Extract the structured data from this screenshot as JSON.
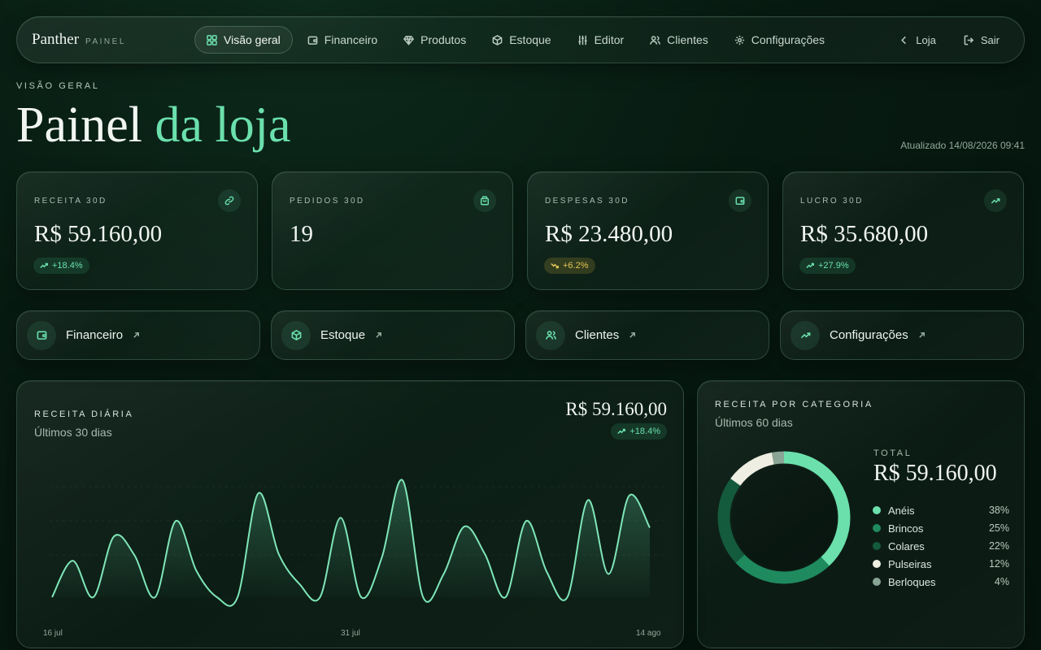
{
  "brand": {
    "name": "Panther",
    "sub": "PAINEL"
  },
  "nav": {
    "items": [
      {
        "label": "Visão geral",
        "icon": "grid-icon",
        "active": true
      },
      {
        "label": "Financeiro",
        "icon": "wallet-icon",
        "active": false
      },
      {
        "label": "Produtos",
        "icon": "diamond-icon",
        "active": false
      },
      {
        "label": "Estoque",
        "icon": "box-icon",
        "active": false
      },
      {
        "label": "Editor",
        "icon": "sliders-icon",
        "active": false
      },
      {
        "label": "Clientes",
        "icon": "users-icon",
        "active": false
      },
      {
        "label": "Configurações",
        "icon": "gear-icon",
        "active": false
      }
    ],
    "loja": "Loja",
    "sair": "Sair"
  },
  "header": {
    "eyebrow": "VISÃO GERAL",
    "title_main": "Painel",
    "title_accent": "da loja",
    "updated": "Atualizado 14/08/2026 09:41"
  },
  "kpis": [
    {
      "label": "RECEITA 30D",
      "value": "R$ 59.160,00",
      "badge": "+18.4%",
      "icon": "link-icon"
    },
    {
      "label": "PEDIDOS 30D",
      "value": "19",
      "badge": "",
      "icon": "bag-icon"
    },
    {
      "label": "DESPESAS 30D",
      "value": "R$ 23.480,00",
      "badge": "+6.2%",
      "icon": "wallet-icon"
    },
    {
      "label": "LUCRO 30D",
      "value": "R$ 35.680,00",
      "badge": "+27.9%",
      "icon": "trend-up-icon"
    }
  ],
  "quick_links": [
    {
      "label": "Financeiro",
      "icon": "wallet-icon"
    },
    {
      "label": "Estoque",
      "icon": "box-icon"
    },
    {
      "label": "Clientes",
      "icon": "users-icon"
    },
    {
      "label": "Configurações",
      "icon": "trend-up-icon"
    }
  ],
  "revenue": {
    "title": "RECEITA DIÁRIA",
    "subtitle": "Últimos 30 dias",
    "total": "R$ 59.160,00",
    "badge": "+18.4%",
    "xticks": [
      "16 jul",
      "31 jul",
      "14 ago"
    ]
  },
  "category": {
    "title": "RECEITA POR CATEGORIA",
    "subtitle": "Últimos 60 dias",
    "total_label": "TOTAL",
    "total_value": "R$ 59.160,00",
    "items": [
      {
        "name": "Anéis",
        "pct": "38%",
        "color": "#6be0ad"
      },
      {
        "name": "Brincos",
        "pct": "25%",
        "color": "#1f8a5e"
      },
      {
        "name": "Colares",
        "pct": "22%",
        "color": "#145a3c"
      },
      {
        "name": "Pulseiras",
        "pct": "12%",
        "color": "#eeeee2"
      },
      {
        "name": "Berloques",
        "pct": "4%",
        "color": "#8aa596"
      }
    ]
  },
  "chart_data": {
    "type": "area",
    "title": "RECEITA DIÁRIA",
    "x": [
      "16 jul",
      "17 jul",
      "18 jul",
      "19 jul",
      "20 jul",
      "21 jul",
      "22 jul",
      "23 jul",
      "24 jul",
      "25 jul",
      "26 jul",
      "27 jul",
      "28 jul",
      "29 jul",
      "30 jul",
      "31 jul",
      "01 ago",
      "02 ago",
      "03 ago",
      "04 ago",
      "05 ago",
      "06 ago",
      "07 ago",
      "08 ago",
      "09 ago",
      "10 ago",
      "11 ago",
      "12 ago",
      "13 ago",
      "14 ago"
    ],
    "values": [
      0,
      1650,
      0,
      2750,
      1900,
      0,
      3450,
      1200,
      0,
      0,
      4700,
      1950,
      600,
      0,
      3600,
      0,
      1800,
      5300,
      0,
      1050,
      3200,
      1950,
      0,
      3450,
      1150,
      0,
      4400,
      1050,
      4600,
      3150
    ],
    "xticks": [
      "16 jul",
      "31 jul",
      "14 ago"
    ],
    "color": "#6be0ad"
  }
}
